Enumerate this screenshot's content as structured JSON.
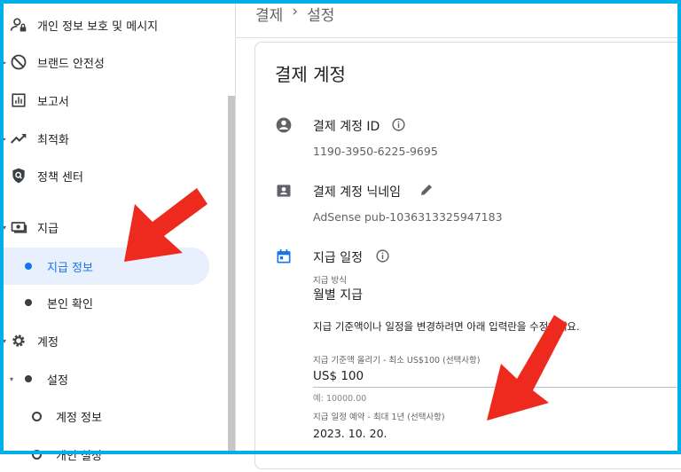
{
  "breadcrumb": {
    "parent": "결제",
    "separator": "›",
    "current": "설정"
  },
  "sidebar": {
    "items": [
      {
        "label": "개인 정보 보호 및 메시지",
        "icon": "person-lock-icon"
      },
      {
        "label": "브랜드 안전성",
        "icon": "block-icon"
      },
      {
        "label": "보고서",
        "icon": "report-icon"
      },
      {
        "label": "최적화",
        "icon": "trending-up-icon"
      },
      {
        "label": "정책 센터",
        "icon": "policy-shield-icon"
      },
      {
        "label": "지급",
        "icon": "payments-icon"
      },
      {
        "label": "지급 정보"
      },
      {
        "label": "본인 확인"
      },
      {
        "label": "계정",
        "icon": "gear-icon"
      },
      {
        "label": "설정"
      },
      {
        "label": "계정 정보"
      },
      {
        "label": "개인 설정"
      }
    ]
  },
  "card": {
    "title": "결제 계정",
    "account_id_label": "결제 계정 ID",
    "account_id_value": "1190-3950-6225-9695",
    "nickname_label": "결제 계정 닉네임",
    "nickname_value": "AdSense pub-1036313325947183",
    "schedule_label": "지급 일정",
    "method_caption": "지급 방식",
    "method_value": "월별 지급",
    "instruction": "지급 기준액이나 일정을 변경하려면 아래 입력란을 수정하세요.",
    "threshold_caption": "지급 기준액 올리기 - 최소 US$100 (선택사항)",
    "threshold_value": "US$ 100",
    "threshold_hint": "예: 10000.00",
    "schedule_caption": "지급 일정 예약 - 최대 1년 (선택사항)",
    "schedule_value": "2023. 10. 20."
  },
  "colors": {
    "accent": "#1a73e8",
    "frame": "#00aeea",
    "arrow": "#ee2a1f"
  }
}
